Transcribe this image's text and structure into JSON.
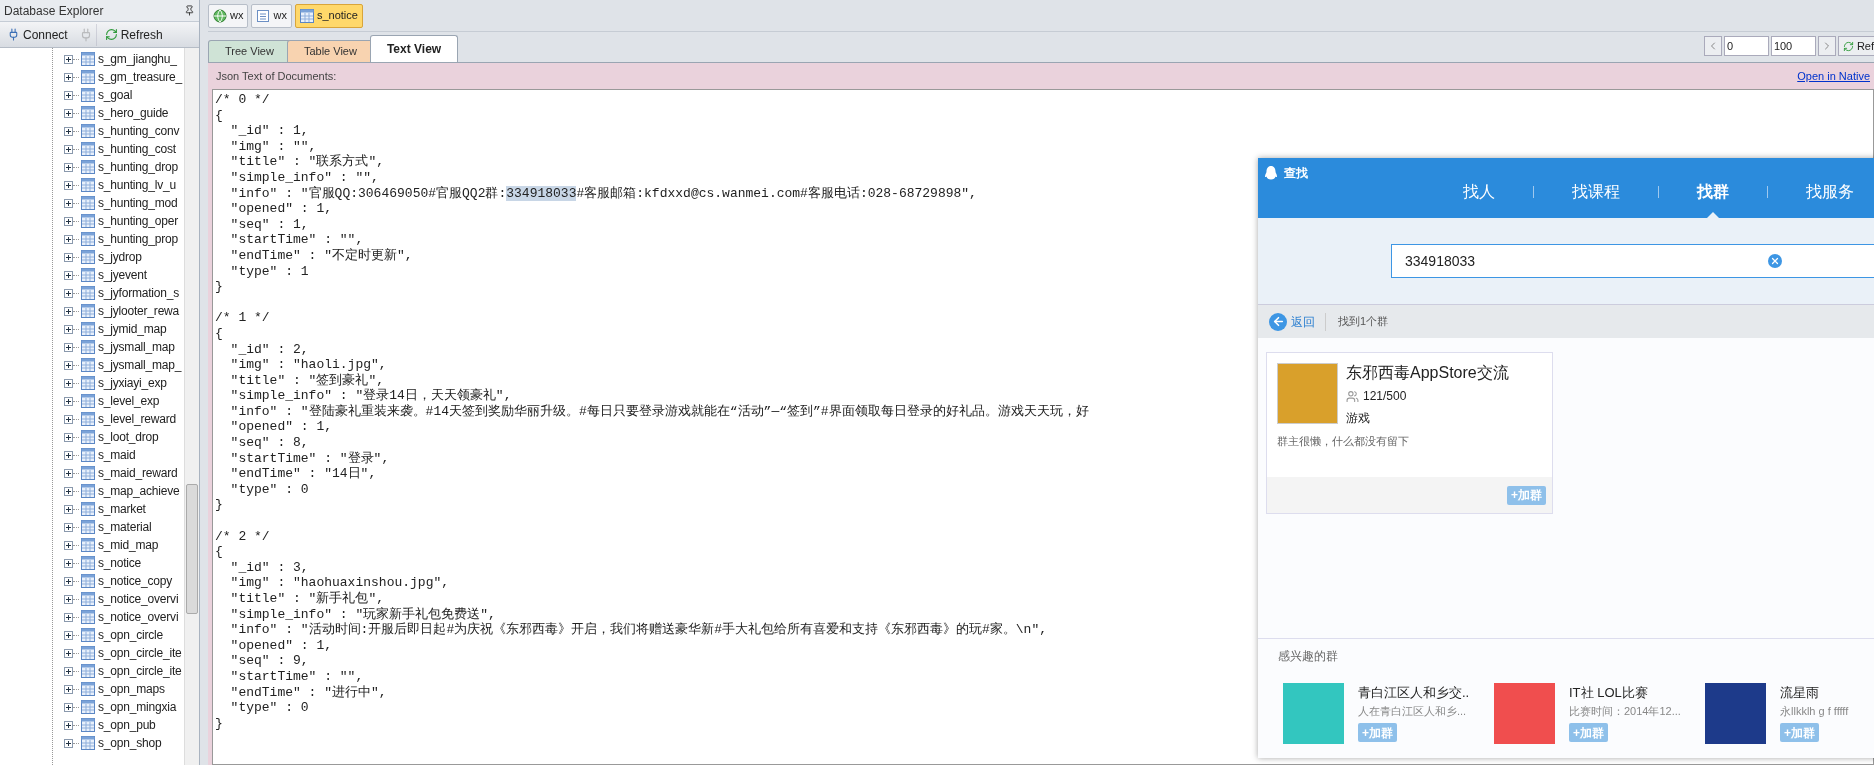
{
  "explorer": {
    "title": "Database Explorer",
    "toolbar": [
      {
        "kind": "connect",
        "label": "Connect",
        "disabled": false
      },
      {
        "kind": "plug",
        "disabled": true
      },
      {
        "kind": "refresh",
        "label": "Refresh",
        "disabled": false
      }
    ],
    "items": [
      {
        "label": "s_gm_jianghu_",
        "expanded": false
      },
      {
        "label": "s_gm_treasure_",
        "expanded": false
      },
      {
        "label": "s_goal",
        "expanded": false
      },
      {
        "label": "s_hero_guide",
        "expanded": false
      },
      {
        "label": "s_hunting_conv",
        "expanded": false
      },
      {
        "label": "s_hunting_cost",
        "expanded": false
      },
      {
        "label": "s_hunting_drop",
        "expanded": false
      },
      {
        "label": "s_hunting_lv_u",
        "expanded": false
      },
      {
        "label": "s_hunting_mod",
        "expanded": false
      },
      {
        "label": "s_hunting_oper",
        "expanded": false
      },
      {
        "label": "s_hunting_prop",
        "expanded": false
      },
      {
        "label": "s_jydrop",
        "expanded": false
      },
      {
        "label": "s_jyevent",
        "expanded": false
      },
      {
        "label": "s_jyformation_s",
        "expanded": false
      },
      {
        "label": "s_jylooter_rewa",
        "expanded": false
      },
      {
        "label": "s_jymid_map",
        "expanded": false
      },
      {
        "label": "s_jysmall_map",
        "expanded": false
      },
      {
        "label": "s_jysmall_map_",
        "expanded": false
      },
      {
        "label": "s_jyxiayi_exp",
        "expanded": false
      },
      {
        "label": "s_level_exp",
        "expanded": false
      },
      {
        "label": "s_level_reward",
        "expanded": false
      },
      {
        "label": "s_loot_drop",
        "expanded": false
      },
      {
        "label": "s_maid",
        "expanded": false
      },
      {
        "label": "s_maid_reward",
        "expanded": false
      },
      {
        "label": "s_map_achieve",
        "expanded": false
      },
      {
        "label": "s_market",
        "expanded": false
      },
      {
        "label": "s_material",
        "expanded": false
      },
      {
        "label": "s_mid_map",
        "expanded": false
      },
      {
        "label": "s_notice",
        "expanded": false
      },
      {
        "label": "s_notice_copy",
        "expanded": false
      },
      {
        "label": "s_notice_overvi",
        "expanded": false
      },
      {
        "label": "s_notice_overvi",
        "expanded": false
      },
      {
        "label": "s_opn_circle",
        "expanded": false
      },
      {
        "label": "s_opn_circle_ite",
        "expanded": false
      },
      {
        "label": "s_opn_circle_ite",
        "expanded": false
      },
      {
        "label": "s_opn_maps",
        "expanded": false
      },
      {
        "label": "s_opn_mingxia",
        "expanded": false
      },
      {
        "label": "s_opn_pub",
        "expanded": false
      },
      {
        "label": "s_opn_shop",
        "expanded": false
      }
    ]
  },
  "doc_tabs": [
    {
      "label": "wx",
      "kind": "server",
      "selected": false
    },
    {
      "label": "wx",
      "kind": "database",
      "selected": false
    },
    {
      "label": "s_notice",
      "kind": "collection",
      "selected": true
    }
  ],
  "view_tabs": [
    {
      "label": "Tree View",
      "color": "#cfe3d6",
      "selected": false
    },
    {
      "label": "Table View",
      "color": "#f8d3b0",
      "selected": false
    },
    {
      "label": "Text View",
      "color": "#ffffff",
      "selected": true
    }
  ],
  "pager": {
    "skip": "0",
    "limit": "100",
    "refresh_label": "Ref"
  },
  "text_view": {
    "header": "Json Text of Documents:",
    "link": "Open in Native",
    "documents": [
      {
        "header": "/* 0 */",
        "lines": [
          {
            "kind": "text",
            "text": "{"
          },
          {
            "kind": "text",
            "text": "  \"_id\" : 1,"
          },
          {
            "kind": "text",
            "text": "  \"img\" : \"\","
          },
          {
            "kind": "text",
            "text": "  \"title\" : \"联系方式\","
          },
          {
            "kind": "text",
            "text": "  \"simple_info\" : \"\","
          },
          {
            "kind": "selection",
            "before": "  \"info\" : \"官服QQ:306469050#官服QQ2群:",
            "selected": "334918033",
            "after": "#客服邮箱:kfdxxd@cs.wanmei.com#客服电话:028-68729898\","
          },
          {
            "kind": "text",
            "text": "  \"opened\" : 1,"
          },
          {
            "kind": "text",
            "text": "  \"seq\" : 1,"
          },
          {
            "kind": "text",
            "text": "  \"startTime\" : \"\","
          },
          {
            "kind": "text",
            "text": "  \"endTime\" : \"不定时更新\","
          },
          {
            "kind": "text",
            "text": "  \"type\" : 1"
          },
          {
            "kind": "text",
            "text": "}"
          }
        ]
      },
      {
        "header": "/* 1 */",
        "lines": [
          {
            "kind": "text",
            "text": "{"
          },
          {
            "kind": "text",
            "text": "  \"_id\" : 2,"
          },
          {
            "kind": "text",
            "text": "  \"img\" : \"haoli.jpg\","
          },
          {
            "kind": "text",
            "text": "  \"title\" : \"签到豪礼\","
          },
          {
            "kind": "text",
            "text": "  \"simple_info\" : \"登录14日，天天领豪礼\","
          },
          {
            "kind": "text",
            "text": "  \"info\" : \"登陆豪礼重装来袭。#14天签到奖励华丽升级。#每日只要登录游戏就能在“活动”—“签到”#界面领取每日登录的好礼品。游戏天天玩，好"
          },
          {
            "kind": "text",
            "text": "  \"opened\" : 1,"
          },
          {
            "kind": "text",
            "text": "  \"seq\" : 8,"
          },
          {
            "kind": "text",
            "text": "  \"startTime\" : \"登录\","
          },
          {
            "kind": "text",
            "text": "  \"endTime\" : \"14日\","
          },
          {
            "kind": "text",
            "text": "  \"type\" : 0"
          },
          {
            "kind": "text",
            "text": "}"
          }
        ]
      },
      {
        "header": "/* 2 */",
        "lines": [
          {
            "kind": "text",
            "text": "{"
          },
          {
            "kind": "text",
            "text": "  \"_id\" : 3,"
          },
          {
            "kind": "text",
            "text": "  \"img\" : \"haohuaxinshou.jpg\","
          },
          {
            "kind": "text",
            "text": "  \"title\" : \"新手礼包\","
          },
          {
            "kind": "text",
            "text": "  \"simple_info\" : \"玩家新手礼包免费送\","
          },
          {
            "kind": "text",
            "text": "  \"info\" : \"活动时间:开服后即日起#为庆祝《东邪西毒》开启，我们将赠送豪华新#手大礼包给所有喜爱和支持《东邪西毒》的玩#家。\\n\","
          },
          {
            "kind": "text",
            "text": "  \"opened\" : 1,"
          },
          {
            "kind": "text",
            "text": "  \"seq\" : 9,"
          },
          {
            "kind": "text",
            "text": "  \"startTime\" : \"\","
          },
          {
            "kind": "text",
            "text": "  \"endTime\" : \"进行中\","
          },
          {
            "kind": "text",
            "text": "  \"type\" : 0"
          },
          {
            "kind": "text",
            "text": "}"
          }
        ]
      }
    ]
  },
  "finder": {
    "title": "查找",
    "tabs": [
      {
        "label": "找人",
        "selected": false
      },
      {
        "label": "找课程",
        "selected": false
      },
      {
        "label": "找群",
        "selected": true
      },
      {
        "label": "找服务",
        "selected": false
      }
    ],
    "search_value": "334918033",
    "back_label": "返回",
    "result_count": "找到1个群",
    "result": {
      "name": "东邪西毒AppStore交流",
      "members": "121/500",
      "category": "游戏",
      "description": "群主很懒，什么都没有留下",
      "join": "+加群"
    },
    "suggest_title": "感兴趣的群",
    "suggestions": [
      {
        "name": "青白江区人和乡交..",
        "description": "人在青白江区人和乡...",
        "join": "+加群",
        "color": "#33c6bf"
      },
      {
        "name": "IT社 LOL比赛",
        "description": "比赛时间：2014年12...",
        "join": "+加群",
        "color": "#f04e4e"
      },
      {
        "name": "流星雨",
        "description": "永llkklh g f fffff",
        "join": "+加群",
        "color": "#1d3a8a"
      }
    ]
  }
}
